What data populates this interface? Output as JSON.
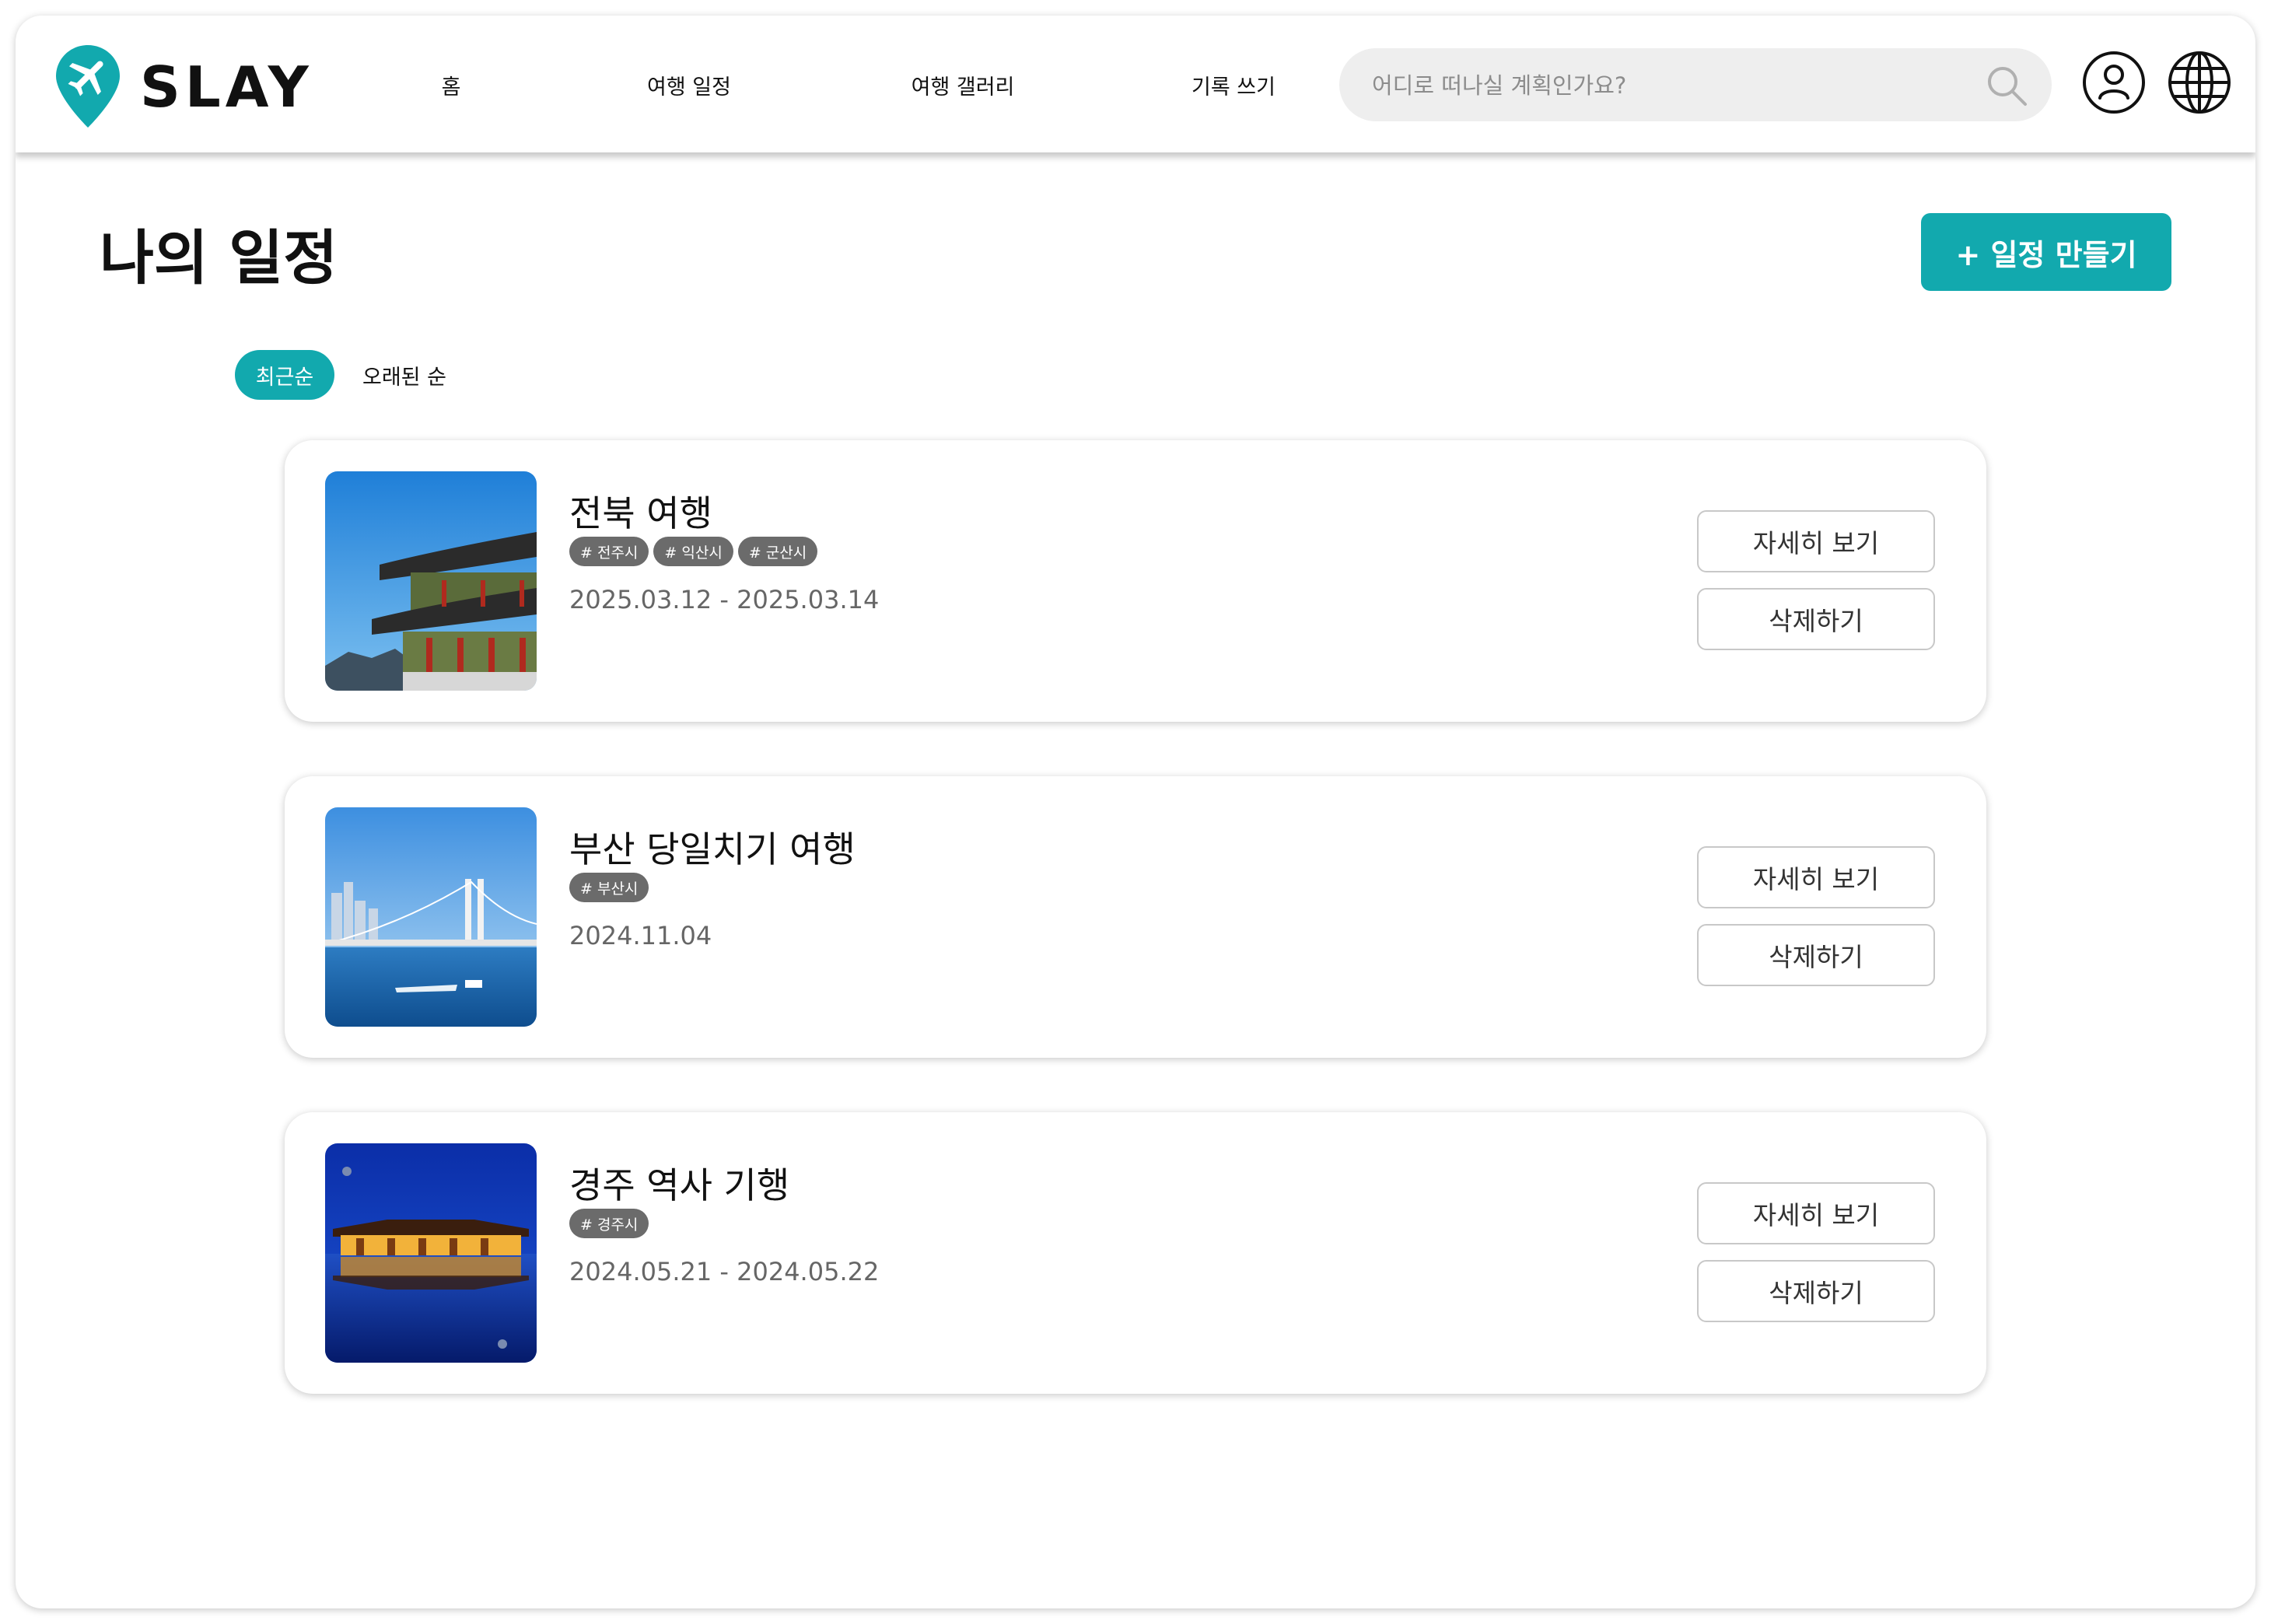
{
  "brand": {
    "name": "SLAY",
    "accent": "#12a9ae"
  },
  "nav": {
    "items": [
      {
        "label": "홈"
      },
      {
        "label": "여행 일정"
      },
      {
        "label": "여행 갤러리"
      },
      {
        "label": "기록 쓰기"
      }
    ]
  },
  "search": {
    "placeholder": "어디로 떠나실 계획인가요?",
    "value": "",
    "icon": "search-icon"
  },
  "header_icons": {
    "user": "user-icon",
    "globe": "globe-icon"
  },
  "page": {
    "title": "나의 일정",
    "create_label": "+ 일정 만들기"
  },
  "sort": {
    "recent": "최근순",
    "oldest": "오래된 순",
    "selected": "최근순"
  },
  "trips": [
    {
      "title": "전북 여행",
      "tags": [
        "# 전주시",
        "# 익산시",
        "# 군산시"
      ],
      "dates": "2025.03.12 - 2025.03.14",
      "detail_label": "자세히 보기",
      "delete_label": "삭제하기"
    },
    {
      "title": "부산 당일치기 여행",
      "tags": [
        "# 부산시"
      ],
      "dates": "2024.11.04",
      "detail_label": "자세히 보기",
      "delete_label": "삭제하기"
    },
    {
      "title": "경주 역사 기행",
      "tags": [
        "# 경주시"
      ],
      "dates": "2024.05.21 - 2024.05.22",
      "detail_label": "자세히 보기",
      "delete_label": "삭제하기"
    }
  ]
}
